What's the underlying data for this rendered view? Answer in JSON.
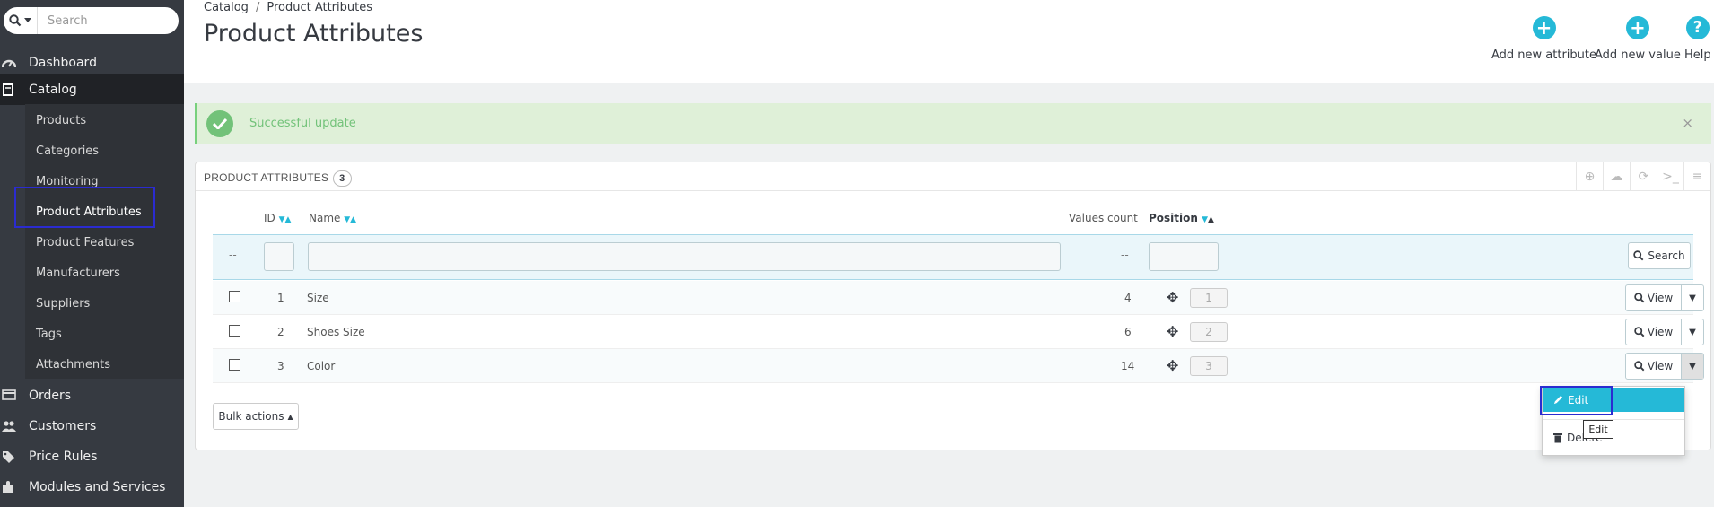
{
  "sidebar": {
    "search_placeholder": "Search",
    "items": [
      {
        "label": "Dashboard",
        "icon": "dashboard-icon"
      },
      {
        "label": "Catalog",
        "icon": "book-icon"
      },
      {
        "label": "Orders",
        "icon": "credit-card-icon"
      },
      {
        "label": "Customers",
        "icon": "users-icon"
      },
      {
        "label": "Price Rules",
        "icon": "tags-icon"
      },
      {
        "label": "Modules and Services",
        "icon": "puzzle-icon"
      }
    ],
    "catalog_sub": [
      "Products",
      "Categories",
      "Monitoring",
      "Product Attributes",
      "Product Features",
      "Manufacturers",
      "Suppliers",
      "Tags",
      "Attachments"
    ]
  },
  "header": {
    "breadcrumb": [
      "Catalog",
      "Product Attributes"
    ],
    "breadcrumb_sep": "/",
    "title": "Product Attributes",
    "actions": [
      {
        "label": "Add new attribute",
        "icon": "plus-circle-icon"
      },
      {
        "label": "Add new value",
        "icon": "plus-circle-icon"
      },
      {
        "label": "Help",
        "icon": "help-circle-icon"
      }
    ]
  },
  "alert": {
    "message": "Successful update",
    "close": "×"
  },
  "panel": {
    "title": "PRODUCT ATTRIBUTES",
    "count": "3",
    "columns": {
      "id": "ID",
      "name": "Name",
      "values_count": "Values count",
      "position": "Position"
    },
    "filter_dash": "--",
    "search_label": "Search",
    "rows": [
      {
        "id": "1",
        "name": "Size",
        "values_count": "4",
        "position": "1"
      },
      {
        "id": "2",
        "name": "Shoes Size",
        "values_count": "6",
        "position": "2"
      },
      {
        "id": "3",
        "name": "Color",
        "values_count": "14",
        "position": "3"
      }
    ],
    "view_label": "View",
    "bulk_label": "Bulk actions"
  },
  "dropdown": {
    "edit": "Edit",
    "delete": "Delete",
    "tooltip": "Edit"
  },
  "colors": {
    "accent": "#25b9d7",
    "sidebar": "#363a41",
    "success": "#72c279"
  }
}
